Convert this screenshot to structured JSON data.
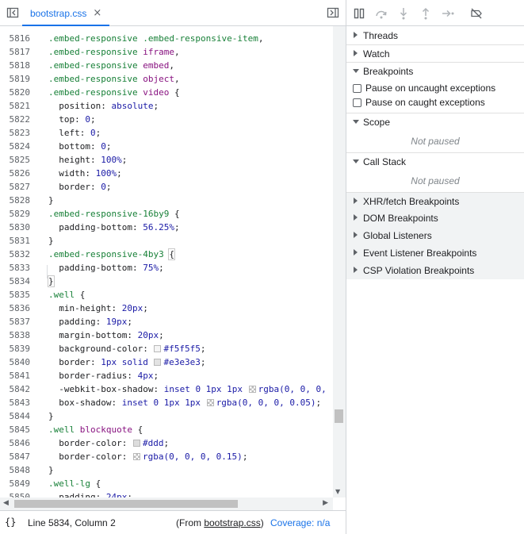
{
  "editor": {
    "tab_label": "bootstrap.css",
    "tab_close": "×",
    "lines": [
      {
        "n": "5816",
        "parts": [
          [
            "sel",
            ".embed-responsive .embed-responsive-item"
          ],
          [
            "punc",
            ","
          ]
        ]
      },
      {
        "n": "5817",
        "parts": [
          [
            "sel",
            ".embed-responsive "
          ],
          [
            "tag",
            "iframe"
          ],
          [
            "punc",
            ","
          ]
        ]
      },
      {
        "n": "5818",
        "parts": [
          [
            "sel",
            ".embed-responsive "
          ],
          [
            "tag",
            "embed"
          ],
          [
            "punc",
            ","
          ]
        ]
      },
      {
        "n": "5819",
        "parts": [
          [
            "sel",
            ".embed-responsive "
          ],
          [
            "tag",
            "object"
          ],
          [
            "punc",
            ","
          ]
        ]
      },
      {
        "n": "5820",
        "parts": [
          [
            "sel",
            ".embed-responsive "
          ],
          [
            "tag",
            "video"
          ],
          [
            "punc",
            " {"
          ]
        ]
      },
      {
        "n": "5821",
        "parts": [
          [
            "prop",
            "  position: "
          ],
          [
            "val",
            "absolute"
          ],
          [
            "punc",
            ";"
          ]
        ]
      },
      {
        "n": "5822",
        "parts": [
          [
            "prop",
            "  top: "
          ],
          [
            "val",
            "0"
          ],
          [
            "punc",
            ";"
          ]
        ]
      },
      {
        "n": "5823",
        "parts": [
          [
            "prop",
            "  left: "
          ],
          [
            "val",
            "0"
          ],
          [
            "punc",
            ";"
          ]
        ]
      },
      {
        "n": "5824",
        "parts": [
          [
            "prop",
            "  bottom: "
          ],
          [
            "val",
            "0"
          ],
          [
            "punc",
            ";"
          ]
        ]
      },
      {
        "n": "5825",
        "parts": [
          [
            "prop",
            "  height: "
          ],
          [
            "val",
            "100%"
          ],
          [
            "punc",
            ";"
          ]
        ]
      },
      {
        "n": "5826",
        "parts": [
          [
            "prop",
            "  width: "
          ],
          [
            "val",
            "100%"
          ],
          [
            "punc",
            ";"
          ]
        ]
      },
      {
        "n": "5827",
        "parts": [
          [
            "prop",
            "  border: "
          ],
          [
            "val",
            "0"
          ],
          [
            "punc",
            ";"
          ]
        ]
      },
      {
        "n": "5828",
        "parts": [
          [
            "punc",
            "}"
          ]
        ]
      },
      {
        "n": "5829",
        "parts": [
          [
            "sel",
            ".embed-responsive-16by9"
          ],
          [
            "punc",
            " {"
          ]
        ]
      },
      {
        "n": "5830",
        "parts": [
          [
            "prop",
            "  padding-bottom: "
          ],
          [
            "val",
            "56.25%"
          ],
          [
            "punc",
            ";"
          ]
        ]
      },
      {
        "n": "5831",
        "parts": [
          [
            "punc",
            "}"
          ]
        ]
      },
      {
        "n": "5832",
        "parts": [
          [
            "sel",
            ".embed-responsive-4by3"
          ],
          [
            "punc",
            " "
          ],
          [
            "hl",
            "{"
          ]
        ]
      },
      {
        "n": "5833",
        "parts": [
          [
            "prop",
            "  padding-bottom: "
          ],
          [
            "val",
            "75%"
          ],
          [
            "punc",
            ";"
          ]
        ]
      },
      {
        "n": "5834",
        "parts": [
          [
            "hl",
            "}"
          ]
        ]
      },
      {
        "n": "5835",
        "parts": [
          [
            "sel",
            ".well"
          ],
          [
            "punc",
            " {"
          ]
        ]
      },
      {
        "n": "5836",
        "parts": [
          [
            "prop",
            "  min-height: "
          ],
          [
            "val",
            "20px"
          ],
          [
            "punc",
            ";"
          ]
        ]
      },
      {
        "n": "5837",
        "parts": [
          [
            "prop",
            "  padding: "
          ],
          [
            "val",
            "19px"
          ],
          [
            "punc",
            ";"
          ]
        ]
      },
      {
        "n": "5838",
        "parts": [
          [
            "prop",
            "  margin-bottom: "
          ],
          [
            "val",
            "20px"
          ],
          [
            "punc",
            ";"
          ]
        ]
      },
      {
        "n": "5839",
        "parts": [
          [
            "prop",
            "  background-color: "
          ],
          [
            "swatch",
            "#f5f5f5"
          ],
          [
            "val",
            "#f5f5f5"
          ],
          [
            "punc",
            ";"
          ]
        ]
      },
      {
        "n": "5840",
        "parts": [
          [
            "prop",
            "  border: "
          ],
          [
            "val",
            "1px solid "
          ],
          [
            "swatch",
            "#e3e3e3"
          ],
          [
            "val",
            "#e3e3e3"
          ],
          [
            "punc",
            ";"
          ]
        ]
      },
      {
        "n": "5841",
        "parts": [
          [
            "prop",
            "  border-radius: "
          ],
          [
            "val",
            "4px"
          ],
          [
            "punc",
            ";"
          ]
        ]
      },
      {
        "n": "5842",
        "parts": [
          [
            "prop",
            "  -webkit-box-shadow: "
          ],
          [
            "val",
            "inset 0 1px 1px "
          ],
          [
            "check",
            ""
          ],
          [
            "val",
            "rgba(0, 0, 0,"
          ]
        ]
      },
      {
        "n": "5843",
        "parts": [
          [
            "prop",
            "  box-shadow: "
          ],
          [
            "val",
            "inset 0 1px 1px "
          ],
          [
            "check",
            ""
          ],
          [
            "val",
            "rgba(0, 0, 0, 0.05)"
          ],
          [
            "punc",
            ";"
          ]
        ]
      },
      {
        "n": "5844",
        "parts": [
          [
            "punc",
            "}"
          ]
        ]
      },
      {
        "n": "5845",
        "parts": [
          [
            "sel",
            ".well "
          ],
          [
            "tag",
            "blockquote"
          ],
          [
            "punc",
            " {"
          ]
        ]
      },
      {
        "n": "5846",
        "parts": [
          [
            "prop",
            "  border-color: "
          ],
          [
            "swatch",
            "#dddddd"
          ],
          [
            "val",
            "#ddd"
          ],
          [
            "punc",
            ";"
          ]
        ]
      },
      {
        "n": "5847",
        "parts": [
          [
            "prop",
            "  border-color: "
          ],
          [
            "check",
            ""
          ],
          [
            "val",
            "rgba(0, 0, 0, 0.15)"
          ],
          [
            "punc",
            ";"
          ]
        ]
      },
      {
        "n": "5848",
        "parts": [
          [
            "punc",
            "}"
          ]
        ]
      },
      {
        "n": "5849",
        "parts": [
          [
            "sel",
            ".well-lg"
          ],
          [
            "punc",
            " {"
          ]
        ]
      },
      {
        "n": "5850",
        "parts": [
          [
            "prop",
            "  padding: "
          ],
          [
            "val",
            "24px"
          ],
          [
            "punc",
            ";"
          ]
        ]
      }
    ]
  },
  "status": {
    "pretty_print": "{}",
    "position": "Line 5834, Column 2",
    "from_prefix": "(From ",
    "from_file": "bootstrap.css",
    "from_suffix": ")",
    "coverage": "Coverage: n/a"
  },
  "debugger": {
    "sections": {
      "threads": "Threads",
      "watch": "Watch",
      "breakpoints": "Breakpoints",
      "scope": "Scope",
      "call_stack": "Call Stack",
      "xhr": "XHR/fetch Breakpoints",
      "dom": "DOM Breakpoints",
      "global": "Global Listeners",
      "event": "Event Listener Breakpoints",
      "csp": "CSP Violation Breakpoints"
    },
    "pause_uncaught": "Pause on uncaught exceptions",
    "pause_caught": "Pause on caught exceptions",
    "scope_status": "Not paused",
    "callstack_status": "Not paused"
  },
  "colors": {
    "accent": "#1a73e8",
    "selector": "#188038",
    "value": "#1a1aa6",
    "tag": "#881280"
  }
}
